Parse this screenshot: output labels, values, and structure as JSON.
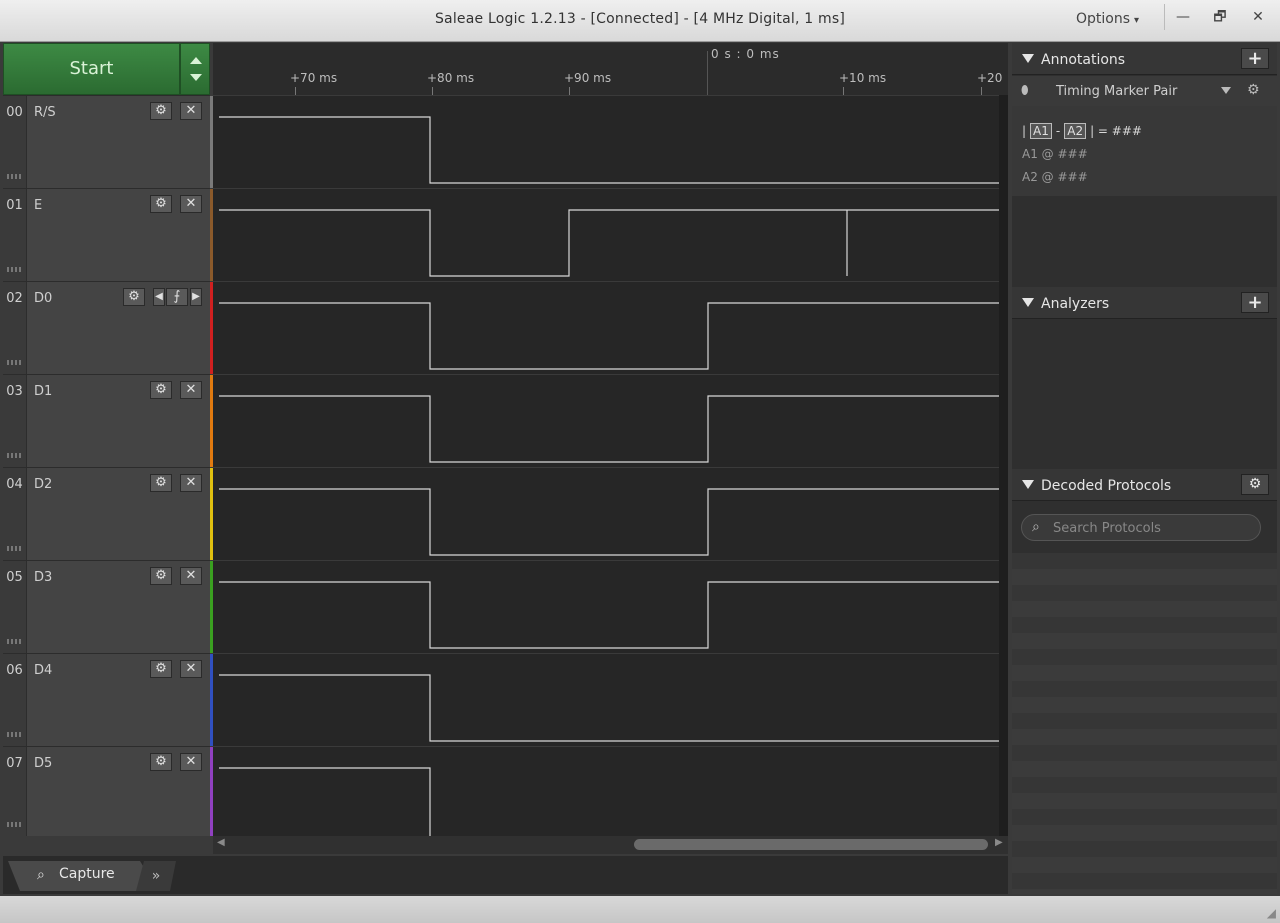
{
  "window": {
    "title": "Saleae Logic 1.2.13 - [Connected] - [4 MHz Digital, 1 ms]",
    "options_label": "Options",
    "minimize": "—",
    "restore": "🗗",
    "close": "✕"
  },
  "start": {
    "label": "Start"
  },
  "ruler": {
    "absolute": "0 s : 0 ms",
    "ticks": [
      "+70 ms",
      "+80 ms",
      "+90 ms",
      "+10 ms",
      "+20"
    ]
  },
  "channels": [
    {
      "num": "00",
      "name": "R/S",
      "color": "#7a7a7a"
    },
    {
      "num": "01",
      "name": "E",
      "color": "#8b5a2b"
    },
    {
      "num": "02",
      "name": "D0",
      "color": "#d02020"
    },
    {
      "num": "03",
      "name": "D1",
      "color": "#e07a10"
    },
    {
      "num": "04",
      "name": "D2",
      "color": "#e0c010"
    },
    {
      "num": "05",
      "name": "D3",
      "color": "#3aa020"
    },
    {
      "num": "06",
      "name": "D4",
      "color": "#3050c0"
    },
    {
      "num": "07",
      "name": "D5",
      "color": "#9040c0"
    }
  ],
  "channel_buttons": {
    "gear": "⚙",
    "close": "✕",
    "prev": "◀",
    "edge": "⨍",
    "next": "▶"
  },
  "annotations": {
    "title": "Annotations",
    "add": "+",
    "marker": "Timing Marker Pair",
    "delta_prefix": "|",
    "a1": "A1",
    "dash": "-",
    "a2": "A2",
    "delta_suffix": "| = ###",
    "a1_line": "A1  @  ###",
    "a2_line": "A2  @  ###"
  },
  "analyzers": {
    "title": "Analyzers",
    "add": "+"
  },
  "decoded": {
    "title": "Decoded Protocols",
    "gear": "⚙",
    "search_placeholder": "Search Protocols"
  },
  "bottom": {
    "capture": "Capture",
    "more": "»"
  }
}
